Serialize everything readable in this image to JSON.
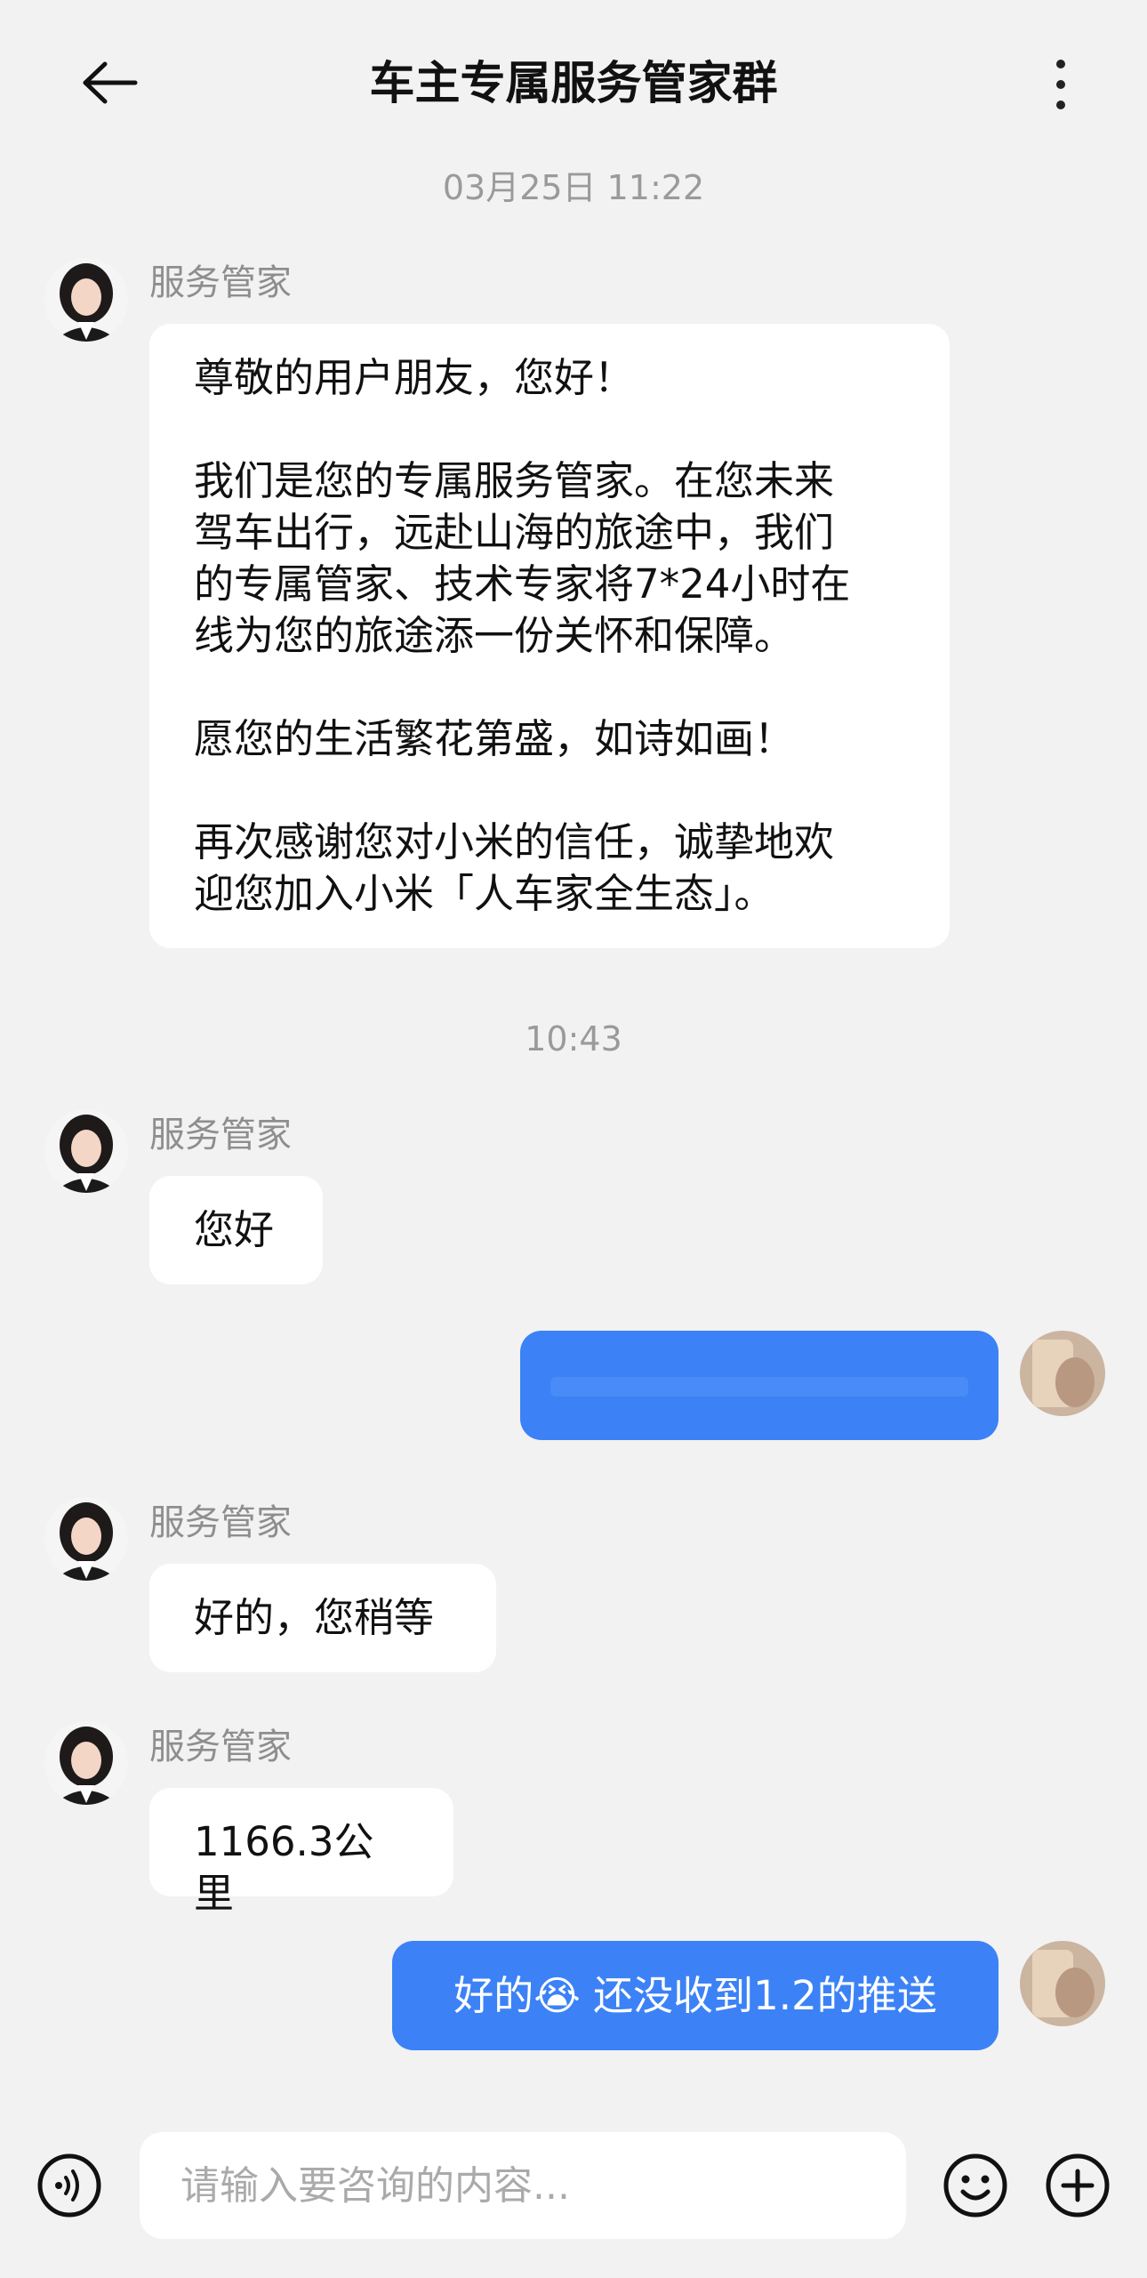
{
  "header": {
    "title": "车主专属服务管家群",
    "back_icon": "arrow-left-icon",
    "more_icon": "more-vertical-icon"
  },
  "timestamps": {
    "first": "03月25日 11:22",
    "second": "10:43"
  },
  "messages": [
    {
      "sender": "服务管家",
      "paragraphs": [
        "尊敬的用户朋友，您好！",
        "我们是您的专属服务管家。在您未来\n驾车出行，远赴山海的旅途中，我们\n的专属管家、技术专家将7*24小时在\n线为您的旅途添一份关怀和保障。",
        "愿您的生活繁花第盛，如诗如画！",
        "再次感谢您对小米的信任，诚挚地欢\n迎您加入小米「人车家全生态」。"
      ]
    },
    {
      "sender": "服务管家",
      "text": "您好"
    },
    {
      "sender": "服务管家",
      "text": "好的，您稍等"
    },
    {
      "sender": "服务管家",
      "text": "1166.3公里"
    }
  ],
  "outgoing": {
    "reply_text_before": "好的",
    "reply_emoji": "😭",
    "reply_text_after": " 还没收到1.2的推送"
  },
  "input": {
    "placeholder": "请输入要咨询的内容..."
  },
  "icons": {
    "voice": "voice-icon",
    "emoji": "emoji-icon",
    "plus": "plus-icon"
  },
  "colors": {
    "background": "#f2f2f2",
    "outgoing_bubble": "#3c82f6",
    "incoming_bubble": "#ffffff"
  }
}
